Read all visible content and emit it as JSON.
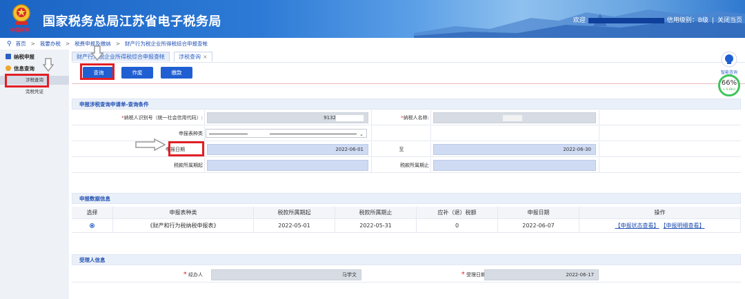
{
  "header": {
    "emblem_text": "中国税务",
    "site_title": "国家税务总局江苏省电子税务局",
    "welcome": "欢迎",
    "credit_level": "信用级别：B级",
    "close_page": "关闭当页"
  },
  "breadcrumb": [
    "首页",
    "我要办税",
    "税费申报及缴纳",
    "财产行为税企业所得税综合申报查帐"
  ],
  "sidebar": {
    "group1": "纳税申报",
    "group2": "信息查询",
    "sub_active": "涉税查询",
    "sub2": "完税凭证"
  },
  "tabs": [
    {
      "label": "财产行为税企业所得税综合申报查帐"
    },
    {
      "label": "涉税查询",
      "close": "×"
    }
  ],
  "toolbar": {
    "query": "查询",
    "void": "作废",
    "pay": "缴款"
  },
  "query_section": {
    "title": "申报涉税查询申请单-查询条件",
    "taxpayer_id_label": "纳税人识别号（统一社会信用代码）:",
    "taxpayer_id_value": "9132",
    "taxpayer_name_label": "纳税人名称:",
    "report_type_label": "申报表种类",
    "report_type_value": "",
    "report_date_label": "申报日期",
    "report_date_from": "2022-06-01",
    "to_label": "至",
    "report_date_to": "2022-06-30",
    "period_start_label": "税款所属期起",
    "period_end_label": "税款所属期止"
  },
  "data_section": {
    "title": "申报数据信息",
    "columns": [
      "选择",
      "申报表种类",
      "税款所属期起",
      "税款所属期止",
      "应补（退）税额",
      "申报日期",
      "操作"
    ],
    "rows": [
      {
        "report_type": "《财产和行为税纳税申报表》",
        "period_start": "2022-05-01",
        "period_end": "2022-05-31",
        "tax_amount": "0",
        "report_date": "2022-06-07",
        "op1": "【申报状态查看】",
        "op2": "【申报明细查看】"
      }
    ]
  },
  "handler_section": {
    "title": "受理人信息",
    "handler_label": "经办人",
    "handler_value": "马学文",
    "accept_date_label": "受理日期",
    "accept_date_value": "2022-06-17"
  },
  "float_widget": {
    "help_label": "智能咨询",
    "speed_pct": "66%",
    "speed_rate": "+ 0.8K/s"
  },
  "colors": {
    "brand_blue": "#1f5fd1",
    "highlight_red": "#e31e24"
  }
}
